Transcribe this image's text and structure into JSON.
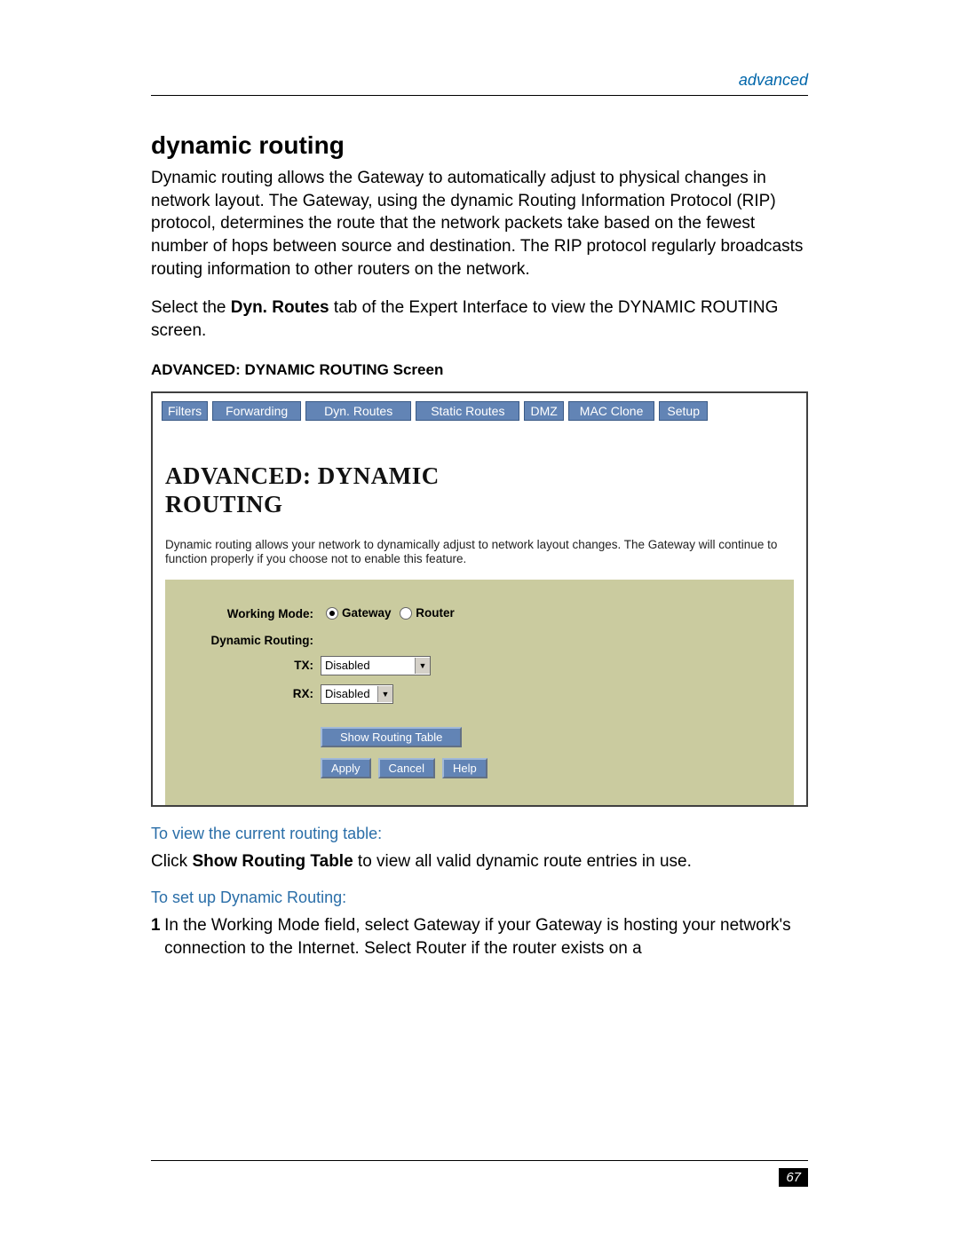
{
  "header": {
    "breadcrumb": "advanced"
  },
  "title": "dynamic routing",
  "intro_para": "Dynamic routing allows the Gateway to automatically adjust to physical changes in network layout. The Gateway, using the dynamic Routing Information Protocol (RIP) protocol, determines the route that the network packets take based on the fewest number of hops between source and destination. The RIP protocol regularly broadcasts routing information to other routers on the network.",
  "select_para_pre": "Select the ",
  "select_bold": "Dyn. Routes",
  "select_para_post": " tab of the Expert Interface to view the DYNAMIC ROUTING screen.",
  "caption": "ADVANCED: DYNAMIC ROUTING Screen",
  "screenshot": {
    "tabs": {
      "filters": "Filters",
      "forwarding": "Forwarding",
      "dyn": "Dyn. Routes",
      "static": "Static Routes",
      "dmz": "DMZ",
      "mac": "MAC Clone",
      "setup": "Setup"
    },
    "screen_title_l1": "ADVANCED: DYNAMIC",
    "screen_title_l2": "ROUTING",
    "screen_desc": "Dynamic routing allows your network to dynamically adjust to network layout changes. The Gateway will continue to function properly if you choose not to enable this feature.",
    "form": {
      "working_mode_label": "Working Mode:",
      "gateway_label": "Gateway",
      "router_label": "Router",
      "dynamic_routing_label": "Dynamic Routing:",
      "tx_label": "TX:",
      "tx_value": "Disabled",
      "rx_label": "RX:",
      "rx_value": "Disabled",
      "show_btn": "Show Routing Table",
      "apply_btn": "Apply",
      "cancel_btn": "Cancel",
      "help_btn": "Help"
    }
  },
  "subhead_view": "To view the current routing table:",
  "view_para_pre": "Click ",
  "view_bold": "Show Routing Table",
  "view_para_post": " to view all valid dynamic route entries in use.",
  "subhead_setup": "To set up Dynamic Routing:",
  "step1_num": "1",
  "step1_pre": "In the Working Mode field, select ",
  "step1_b1": "Gateway",
  "step1_mid": " if your Gateway is hosting your network's connection to the Internet. Select ",
  "step1_b2": "Router",
  "step1_post": " if the router exists on a",
  "page_number": "67"
}
